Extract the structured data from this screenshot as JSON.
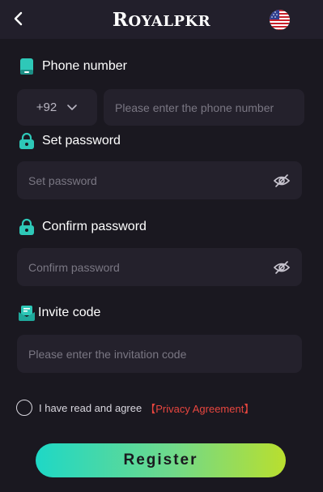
{
  "header": {
    "logo_first": "R",
    "logo_rest": "OYALPKR",
    "language_flag": "us-flag-icon"
  },
  "phone": {
    "label": "Phone number",
    "country_code": "+92",
    "placeholder": "Please enter the phone number"
  },
  "password": {
    "label": "Set password",
    "placeholder": "Set password"
  },
  "confirm": {
    "label": "Confirm password",
    "placeholder": "Confirm password"
  },
  "invite": {
    "label": "Invite code",
    "placeholder": "Please enter the invitation code"
  },
  "agreement": {
    "text": "I have read and agree",
    "link": "【Privacy Agreement】"
  },
  "register_label": "Register",
  "colors": {
    "background": "#1a1820",
    "field": "#24212c",
    "accent_teal": "#2ec8b8",
    "link_red": "#e8463f",
    "button_gradient_start": "#1ed8c6",
    "button_gradient_end": "#b9df2e"
  }
}
